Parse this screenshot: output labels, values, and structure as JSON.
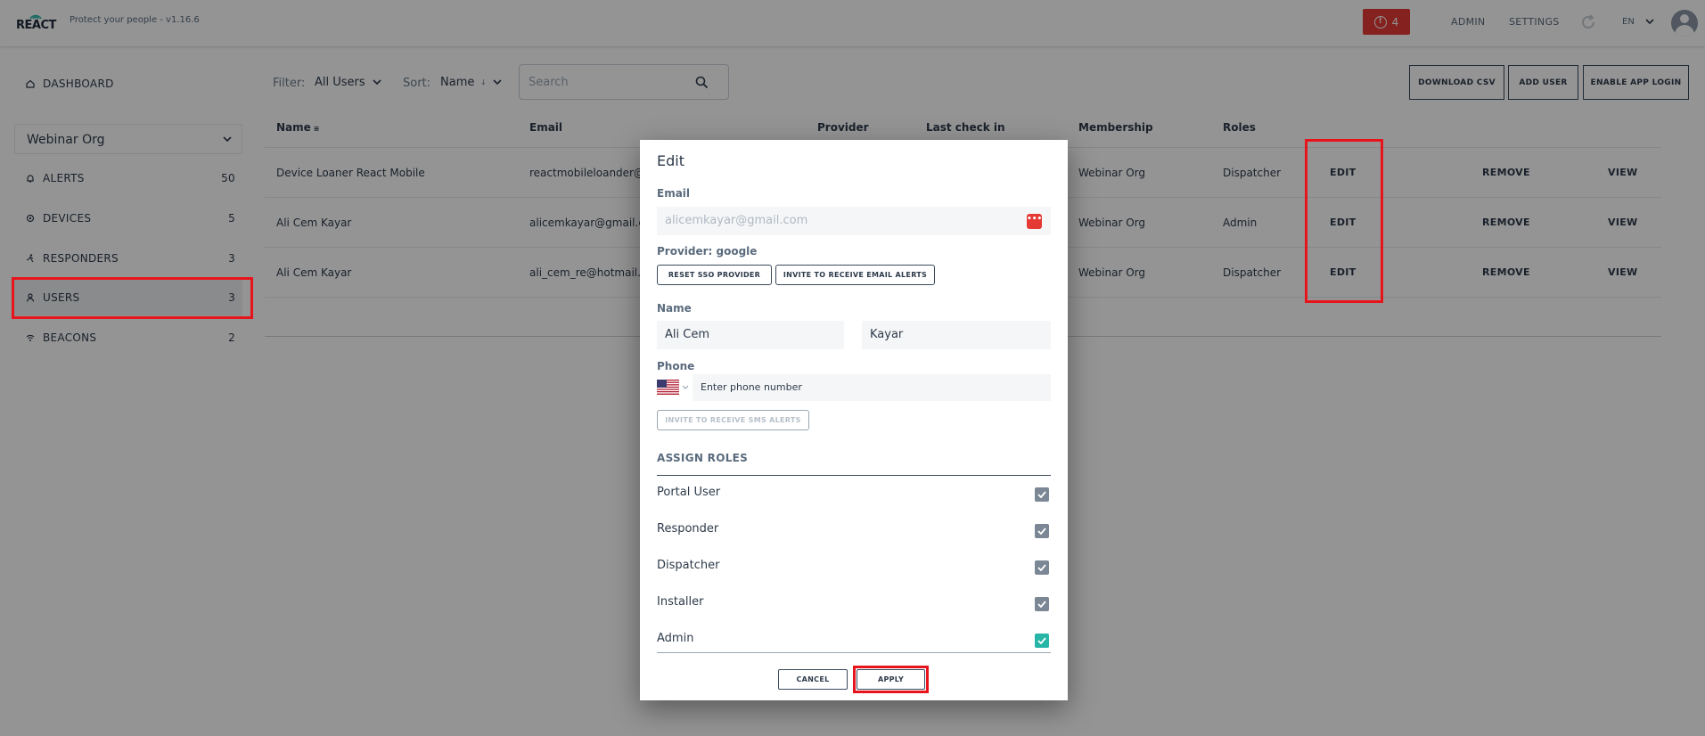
{
  "app": {
    "logo_text": "REACT",
    "tagline": "Protect your people - v1.16.6",
    "alert_count": "4",
    "nav_admin": "ADMIN",
    "nav_settings": "SETTINGS",
    "language": "EN"
  },
  "sidebar": {
    "dashboard": "DASHBOARD",
    "org": "Webinar Org",
    "items": [
      {
        "label": "ALERTS",
        "count": "50",
        "icon": "bell-icon"
      },
      {
        "label": "DEVICES",
        "count": "5",
        "icon": "device-icon"
      },
      {
        "label": "RESPONDERS",
        "count": "3",
        "icon": "runner-icon"
      },
      {
        "label": "USERS",
        "count": "3",
        "icon": "user-icon"
      },
      {
        "label": "BEACONS",
        "count": "2",
        "icon": "wifi-icon"
      }
    ]
  },
  "toolbar": {
    "filter_label": "Filter:",
    "filter_value": "All Users",
    "sort_label": "Sort:",
    "sort_value": "Name",
    "search_placeholder": "Search",
    "download_csv": "DOWNLOAD CSV",
    "add_user": "ADD USER",
    "enable_app_login": "ENABLE APP LOGIN"
  },
  "table": {
    "headers": {
      "name": "Name",
      "email": "Email",
      "provider": "Provider",
      "last_check_in": "Last check in",
      "membership": "Membership",
      "roles": "Roles"
    },
    "rows": [
      {
        "name": "Device Loaner React Mobile",
        "email": "reactmobileloander@",
        "membership": "Webinar Org",
        "roles": "Dispatcher"
      },
      {
        "name": "Ali Cem Kayar",
        "email": "alicemkayar@gmail.c",
        "membership": "Webinar Org",
        "roles": "Admin"
      },
      {
        "name": "Ali Cem Kayar",
        "email": "ali_cem_re@hotmail.c",
        "membership": "Webinar Org",
        "roles": "Dispatcher"
      }
    ],
    "actions": {
      "edit": "EDIT",
      "remove": "REMOVE",
      "view": "VIEW"
    }
  },
  "modal": {
    "title": "Edit",
    "email_label": "Email",
    "email_value": "alicemkayar@gmail.com",
    "provider_label": "Provider: google",
    "reset_sso": "RESET SSO PROVIDER",
    "invite_email": "INVITE TO RECEIVE EMAIL ALERTS",
    "name_label": "Name",
    "first_name": "Ali Cem",
    "last_name": "Kayar",
    "phone_label": "Phone",
    "phone_placeholder": "Enter phone number",
    "invite_sms": "INVITE TO RECEIVE SMS ALERTS",
    "assign_roles": "ASSIGN ROLES",
    "roles": [
      {
        "label": "Portal User",
        "checked": true
      },
      {
        "label": "Responder",
        "checked": true
      },
      {
        "label": "Dispatcher",
        "checked": true
      },
      {
        "label": "Installer",
        "checked": true
      },
      {
        "label": "Admin",
        "checked": true
      }
    ],
    "cancel": "CANCEL",
    "apply": "APPLY"
  },
  "colors": {
    "alert_red": "#e53935",
    "annotation_red": "#e8141c",
    "checkbox_teal": "#26b5a6",
    "checkbox_gray": "#7b8794"
  }
}
